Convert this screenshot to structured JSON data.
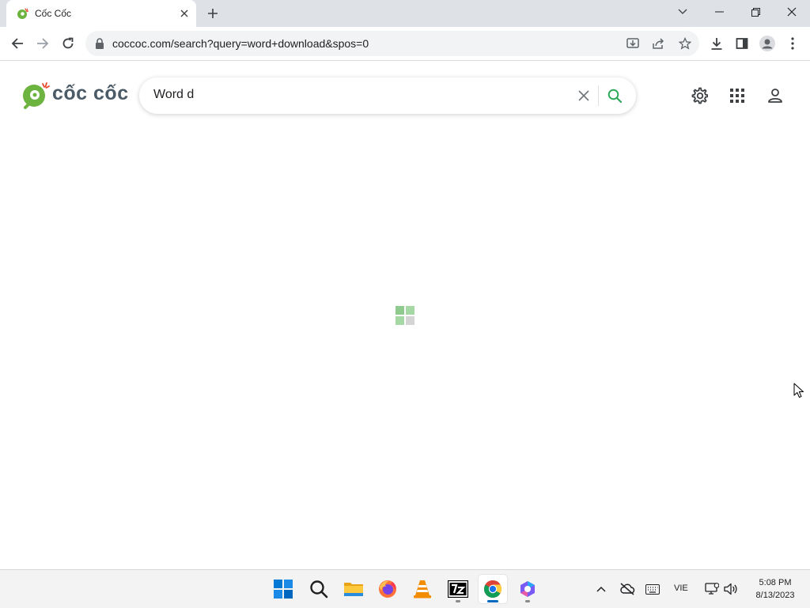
{
  "browser": {
    "tab": {
      "title": "Cốc Cốc"
    },
    "address_bar": {
      "url": "coccoc.com/search?query=word+download&spos=0"
    }
  },
  "page": {
    "logo": {
      "text": "cốc cốc"
    },
    "search": {
      "value": "Word d"
    }
  },
  "taskbar": {
    "apps": [
      "start-icon",
      "search-icon",
      "file-explorer-icon",
      "firefox-icon",
      "vlc-icon",
      "7zip-icon",
      "chrome-icon",
      "copilot-icon"
    ],
    "tray": {
      "language": "VIE",
      "time": "5:08 PM",
      "date": "8/13/2023"
    }
  },
  "colors": {
    "brand_green": "#6cb33f",
    "brand_red": "#e8462b",
    "active_indicator": "#0067c0"
  }
}
